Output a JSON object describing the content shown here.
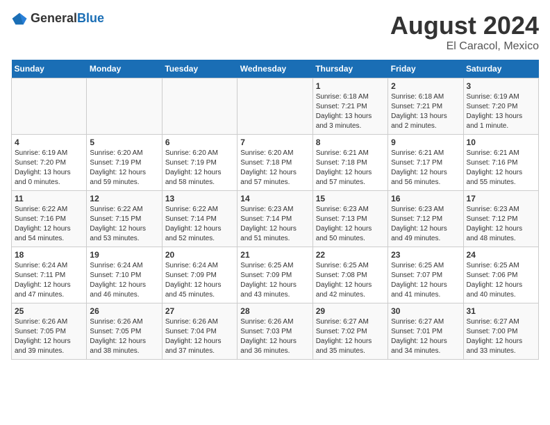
{
  "header": {
    "logo_general": "General",
    "logo_blue": "Blue",
    "title": "August 2024",
    "subtitle": "El Caracol, Mexico"
  },
  "calendar": {
    "days_of_week": [
      "Sunday",
      "Monday",
      "Tuesday",
      "Wednesday",
      "Thursday",
      "Friday",
      "Saturday"
    ],
    "weeks": [
      [
        {
          "day": "",
          "info": ""
        },
        {
          "day": "",
          "info": ""
        },
        {
          "day": "",
          "info": ""
        },
        {
          "day": "",
          "info": ""
        },
        {
          "day": "1",
          "info": "Sunrise: 6:18 AM\nSunset: 7:21 PM\nDaylight: 13 hours\nand 3 minutes."
        },
        {
          "day": "2",
          "info": "Sunrise: 6:18 AM\nSunset: 7:21 PM\nDaylight: 13 hours\nand 2 minutes."
        },
        {
          "day": "3",
          "info": "Sunrise: 6:19 AM\nSunset: 7:20 PM\nDaylight: 13 hours\nand 1 minute."
        }
      ],
      [
        {
          "day": "4",
          "info": "Sunrise: 6:19 AM\nSunset: 7:20 PM\nDaylight: 13 hours\nand 0 minutes."
        },
        {
          "day": "5",
          "info": "Sunrise: 6:20 AM\nSunset: 7:19 PM\nDaylight: 12 hours\nand 59 minutes."
        },
        {
          "day": "6",
          "info": "Sunrise: 6:20 AM\nSunset: 7:19 PM\nDaylight: 12 hours\nand 58 minutes."
        },
        {
          "day": "7",
          "info": "Sunrise: 6:20 AM\nSunset: 7:18 PM\nDaylight: 12 hours\nand 57 minutes."
        },
        {
          "day": "8",
          "info": "Sunrise: 6:21 AM\nSunset: 7:18 PM\nDaylight: 12 hours\nand 57 minutes."
        },
        {
          "day": "9",
          "info": "Sunrise: 6:21 AM\nSunset: 7:17 PM\nDaylight: 12 hours\nand 56 minutes."
        },
        {
          "day": "10",
          "info": "Sunrise: 6:21 AM\nSunset: 7:16 PM\nDaylight: 12 hours\nand 55 minutes."
        }
      ],
      [
        {
          "day": "11",
          "info": "Sunrise: 6:22 AM\nSunset: 7:16 PM\nDaylight: 12 hours\nand 54 minutes."
        },
        {
          "day": "12",
          "info": "Sunrise: 6:22 AM\nSunset: 7:15 PM\nDaylight: 12 hours\nand 53 minutes."
        },
        {
          "day": "13",
          "info": "Sunrise: 6:22 AM\nSunset: 7:14 PM\nDaylight: 12 hours\nand 52 minutes."
        },
        {
          "day": "14",
          "info": "Sunrise: 6:23 AM\nSunset: 7:14 PM\nDaylight: 12 hours\nand 51 minutes."
        },
        {
          "day": "15",
          "info": "Sunrise: 6:23 AM\nSunset: 7:13 PM\nDaylight: 12 hours\nand 50 minutes."
        },
        {
          "day": "16",
          "info": "Sunrise: 6:23 AM\nSunset: 7:12 PM\nDaylight: 12 hours\nand 49 minutes."
        },
        {
          "day": "17",
          "info": "Sunrise: 6:23 AM\nSunset: 7:12 PM\nDaylight: 12 hours\nand 48 minutes."
        }
      ],
      [
        {
          "day": "18",
          "info": "Sunrise: 6:24 AM\nSunset: 7:11 PM\nDaylight: 12 hours\nand 47 minutes."
        },
        {
          "day": "19",
          "info": "Sunrise: 6:24 AM\nSunset: 7:10 PM\nDaylight: 12 hours\nand 46 minutes."
        },
        {
          "day": "20",
          "info": "Sunrise: 6:24 AM\nSunset: 7:09 PM\nDaylight: 12 hours\nand 45 minutes."
        },
        {
          "day": "21",
          "info": "Sunrise: 6:25 AM\nSunset: 7:09 PM\nDaylight: 12 hours\nand 43 minutes."
        },
        {
          "day": "22",
          "info": "Sunrise: 6:25 AM\nSunset: 7:08 PM\nDaylight: 12 hours\nand 42 minutes."
        },
        {
          "day": "23",
          "info": "Sunrise: 6:25 AM\nSunset: 7:07 PM\nDaylight: 12 hours\nand 41 minutes."
        },
        {
          "day": "24",
          "info": "Sunrise: 6:25 AM\nSunset: 7:06 PM\nDaylight: 12 hours\nand 40 minutes."
        }
      ],
      [
        {
          "day": "25",
          "info": "Sunrise: 6:26 AM\nSunset: 7:05 PM\nDaylight: 12 hours\nand 39 minutes."
        },
        {
          "day": "26",
          "info": "Sunrise: 6:26 AM\nSunset: 7:05 PM\nDaylight: 12 hours\nand 38 minutes."
        },
        {
          "day": "27",
          "info": "Sunrise: 6:26 AM\nSunset: 7:04 PM\nDaylight: 12 hours\nand 37 minutes."
        },
        {
          "day": "28",
          "info": "Sunrise: 6:26 AM\nSunset: 7:03 PM\nDaylight: 12 hours\nand 36 minutes."
        },
        {
          "day": "29",
          "info": "Sunrise: 6:27 AM\nSunset: 7:02 PM\nDaylight: 12 hours\nand 35 minutes."
        },
        {
          "day": "30",
          "info": "Sunrise: 6:27 AM\nSunset: 7:01 PM\nDaylight: 12 hours\nand 34 minutes."
        },
        {
          "day": "31",
          "info": "Sunrise: 6:27 AM\nSunset: 7:00 PM\nDaylight: 12 hours\nand 33 minutes."
        }
      ]
    ]
  }
}
